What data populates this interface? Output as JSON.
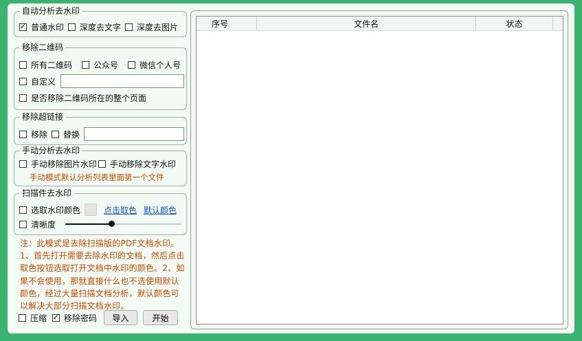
{
  "auto_watermark": {
    "title": "自动分析去水印",
    "options": [
      {
        "label": "普通水印",
        "checked": true
      },
      {
        "label": "深度去文字",
        "checked": false
      },
      {
        "label": "深度去图片",
        "checked": false
      }
    ]
  },
  "qr_code": {
    "title": "移除二维码",
    "options": [
      {
        "label": "所有二维码",
        "checked": false
      },
      {
        "label": "公众号",
        "checked": false
      },
      {
        "label": "微信个人号",
        "checked": false
      }
    ],
    "custom_label": "自定义",
    "custom_value": "",
    "whole_page_label": "是否移除二维码所在的整个页面"
  },
  "hyperlink": {
    "title": "移除超链接",
    "remove_label": "移除",
    "replace_label": "替换",
    "replace_value": ""
  },
  "manual_watermark": {
    "title": "手动分析去水印",
    "image_label": "手动移除图片水印",
    "text_label": "手动移除文字水印",
    "hint": "手动模式默认分析列表里面第一个文件"
  },
  "scan_watermark": {
    "title": "扫描件去水印",
    "pick_color_label": "选取水印颜色",
    "click_pick_label": "点击取色",
    "default_color_label": "默认颜色",
    "swatch_color": "#e3e3e3",
    "clarity_label": "清晰度",
    "clarity_level": 0.4
  },
  "note": "注：此模式是去除扫描版的PDF文档水印。1、首先打开需要去除水印的文档，然后点击取色按钮选取打开文档中水印的颜色。2、如果不会使用，那就直接什么也不选使用默认颜色，经过大量扫描文档分析，默认颜色可以解决大部分扫描文档水印。",
  "bottom": {
    "compress_label": "压缩",
    "compress_checked": false,
    "remove_password_label": "移除密码",
    "remove_password_checked": true,
    "import_button": "导入",
    "start_button": "开始"
  },
  "file_list": {
    "columns": [
      "序号",
      "文件名",
      "状态"
    ],
    "rows": []
  },
  "colors": {
    "background": "#3cb371",
    "panel": "#f1fbf3",
    "hint_orange": "#d04a00",
    "link_blue": "#1a4fd0"
  }
}
